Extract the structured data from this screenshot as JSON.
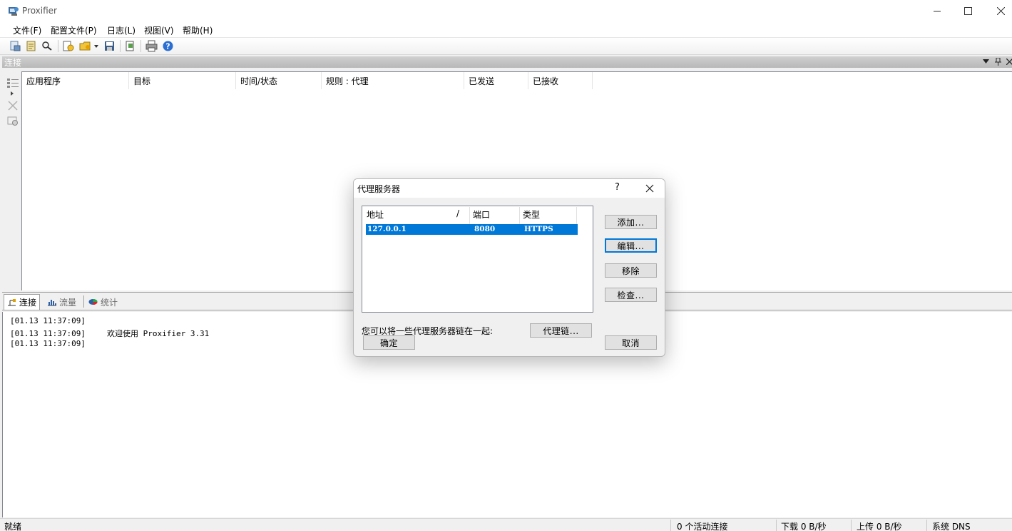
{
  "window": {
    "title": "Proxifier"
  },
  "menu": [
    "文件(F)",
    "配置文件(P)",
    "日志(L)",
    "视图(V)",
    "帮助(H)"
  ],
  "toolbar_icons": [
    "new-profile-icon",
    "profile-icon",
    "search-icon",
    "add-icon",
    "open-folder-icon",
    "save-icon",
    "proxy-settings-icon",
    "print-icon",
    "help-icon"
  ],
  "pane": {
    "title": "连接"
  },
  "columns": [
    "应用程序",
    "目标",
    "时间/状态",
    "规则 : 代理",
    "已发送",
    "已接收"
  ],
  "tabs": [
    {
      "label": "连接",
      "icon": "connections-icon"
    },
    {
      "label": "流量",
      "icon": "traffic-icon"
    },
    {
      "label": "统计",
      "icon": "statistics-icon"
    }
  ],
  "log": [
    {
      "time": "[01.13 11:37:09]",
      "msg": ""
    },
    {
      "time": "[01.13 11:37:09]",
      "msg": "欢迎使用 Proxifier 3.31"
    },
    {
      "time": "[01.13 11:37:09]",
      "msg": ""
    }
  ],
  "status": {
    "ready": "就绪",
    "active": "0 个活动连接",
    "download": "下载 0 B/秒",
    "upload": "上传 0 B/秒",
    "dns": "系统 DNS"
  },
  "dialog": {
    "title": "代理服务器",
    "help": "?",
    "headers": {
      "address": "地址",
      "sort": "/",
      "port": "端口",
      "type": "类型"
    },
    "rows": [
      {
        "address": "127.0.0.1",
        "port": "8080",
        "type": "HTTPS"
      }
    ],
    "buttons": {
      "add": "添加...",
      "edit": "编辑...",
      "remove": "移除",
      "check": "检查...",
      "ok": "确定",
      "cancel": "取消",
      "chain": "代理链..."
    },
    "chain_text": "您可以将一些代理服务器链在一起:"
  },
  "colors": {
    "selection": "#0078d7",
    "pane_header": "#b8b8b8"
  }
}
